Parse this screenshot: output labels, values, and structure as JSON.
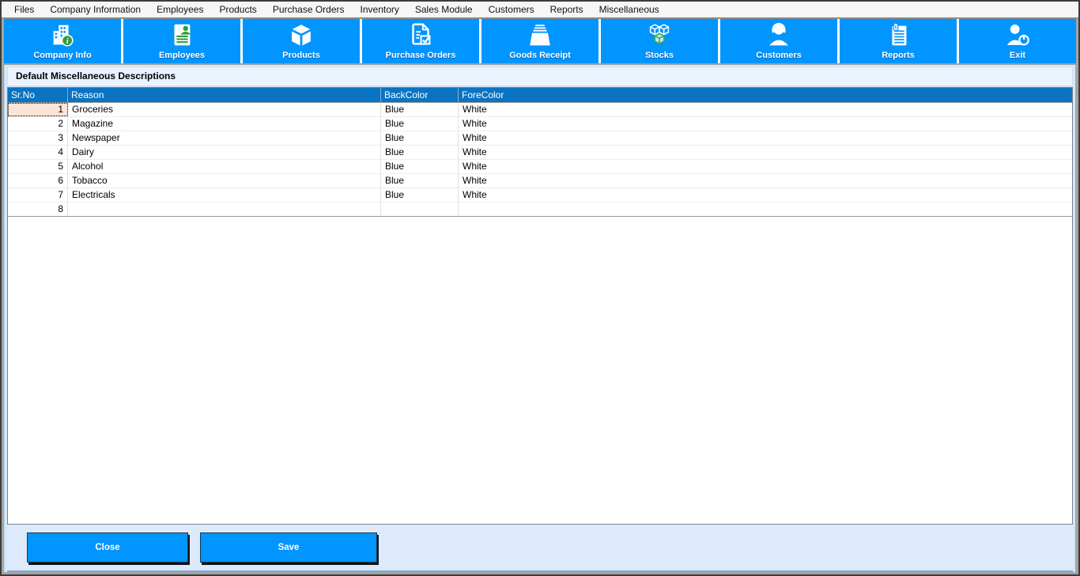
{
  "menu_bar": {
    "items": [
      "Files",
      "Company Information",
      "Employees",
      "Products",
      "Purchase Orders",
      "Inventory",
      "Sales Module",
      "Customers",
      "Reports",
      "Miscellaneous"
    ]
  },
  "toolbar": {
    "buttons": [
      {
        "label": "Company Info",
        "icon": "company-info-icon"
      },
      {
        "label": "Employees",
        "icon": "employees-icon"
      },
      {
        "label": "Products",
        "icon": "products-icon"
      },
      {
        "label": "Purchase Orders",
        "icon": "purchase-orders-icon"
      },
      {
        "label": "Goods Receipt",
        "icon": "goods-receipt-icon"
      },
      {
        "label": "Stocks",
        "icon": "stocks-icon"
      },
      {
        "label": "Customers",
        "icon": "customers-icon"
      },
      {
        "label": "Reports",
        "icon": "reports-icon"
      },
      {
        "label": "Exit",
        "icon": "exit-icon"
      }
    ]
  },
  "section": {
    "title": "Default Miscellaneous Descriptions"
  },
  "grid": {
    "columns": [
      "Sr.No",
      "Reason",
      "BackColor",
      "ForeColor"
    ],
    "rows": [
      {
        "sr_no": "1",
        "reason": "Groceries",
        "back_color": "Blue",
        "fore_color": "White",
        "focused": true
      },
      {
        "sr_no": "2",
        "reason": "Magazine",
        "back_color": "Blue",
        "fore_color": "White"
      },
      {
        "sr_no": "3",
        "reason": "Newspaper",
        "back_color": "Blue",
        "fore_color": "White"
      },
      {
        "sr_no": "4",
        "reason": "Dairy",
        "back_color": "Blue",
        "fore_color": "White"
      },
      {
        "sr_no": "5",
        "reason": "Alcohol",
        "back_color": "Blue",
        "fore_color": "White"
      },
      {
        "sr_no": "6",
        "reason": "Tobacco",
        "back_color": "Blue",
        "fore_color": "White"
      },
      {
        "sr_no": "7",
        "reason": "Electricals",
        "back_color": "Blue",
        "fore_color": "White"
      },
      {
        "sr_no": "8",
        "reason": "",
        "back_color": "",
        "fore_color": ""
      }
    ]
  },
  "footer": {
    "close_label": "Close",
    "save_label": "Save"
  },
  "colors": {
    "toolbar_blue": "#0095ff",
    "grid_header_blue": "#0a73c2",
    "content_bg": "#d6e8fa",
    "section_bar_bg": "#e9f2fd",
    "footer_bg": "#ddeafb",
    "focused_cell_bg": "#fce4d6",
    "icon_green": "#2f9e3f"
  }
}
